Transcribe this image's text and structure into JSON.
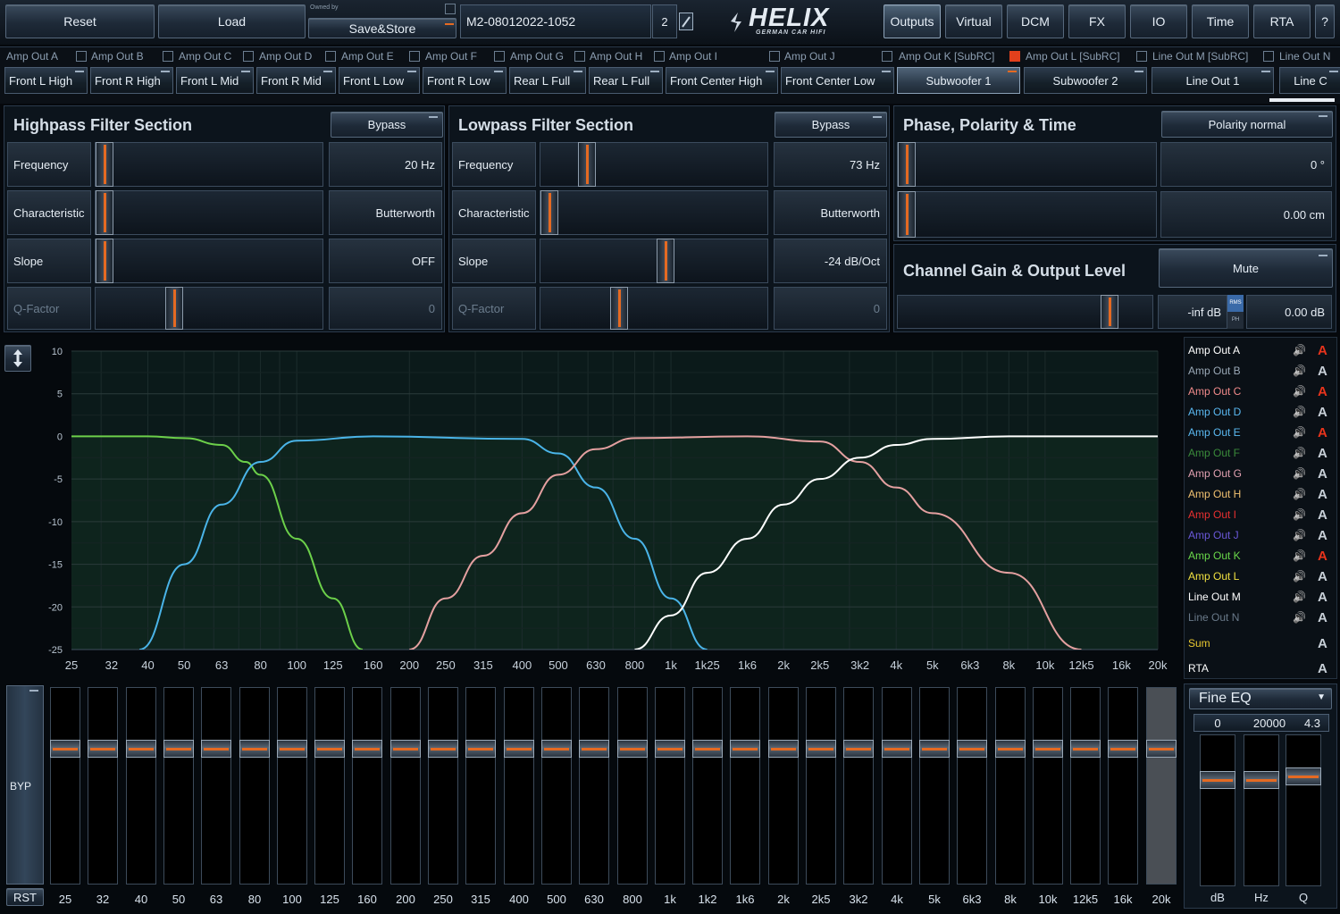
{
  "topbar": {
    "reset": "Reset",
    "load": "Load",
    "owned_by": "Owned by",
    "save_store": "Save&Store",
    "preset_name": "M2-08012022-1052",
    "preset_number": "2",
    "logo_text": "HELIX",
    "logo_sub": "GERMAN CAR HIFI",
    "nav": [
      "Outputs",
      "Virtual",
      "DCM",
      "FX",
      "IO",
      "Time",
      "RTA",
      "?"
    ],
    "active_nav": "Outputs"
  },
  "channels": {
    "labels": [
      "Amp Out A",
      "Amp Out B",
      "Amp Out C",
      "Amp Out D",
      "Amp Out E",
      "Amp Out F",
      "Amp Out G",
      "Amp Out H",
      "Amp Out I",
      "Amp Out J",
      "Amp Out K [SubRC]",
      "Amp Out L [SubRC]",
      "Line Out M [SubRC]",
      "Line Out N"
    ],
    "names": [
      "Front L High",
      "Front R High",
      "Front L Mid",
      "Front R Mid",
      "Front L Low",
      "Front R Low",
      "Rear L Full",
      "Rear L Full",
      "Front Center High",
      "Front Center Low",
      "Subwoofer 1",
      "Subwoofer 2",
      "Line Out 1",
      "Line C"
    ],
    "selected": "Subwoofer 1"
  },
  "highpass": {
    "title": "Highpass Filter Section",
    "bypass": "Bypass",
    "rows": [
      {
        "label": "Frequency",
        "value": "20 Hz"
      },
      {
        "label": "Characteristic",
        "value": "Butterworth"
      },
      {
        "label": "Slope",
        "value": "OFF"
      },
      {
        "label": "Q-Factor",
        "value": "0"
      }
    ],
    "positions": [
      0.0,
      0.0,
      0.0,
      0.33
    ]
  },
  "lowpass": {
    "title": "Lowpass Filter Section",
    "bypass": "Bypass",
    "rows": [
      {
        "label": "Frequency",
        "value": "73 Hz"
      },
      {
        "label": "Characteristic",
        "value": "Butterworth"
      },
      {
        "label": "Slope",
        "value": "-24 dB/Oct"
      },
      {
        "label": "Q-Factor",
        "value": "0"
      }
    ],
    "positions": [
      0.18,
      0.0,
      0.55,
      0.33
    ]
  },
  "phase": {
    "title": "Phase, Polarity & Time",
    "polarity": "Polarity normal",
    "phase_value": "0 °",
    "time_value": "0.00 cm"
  },
  "gain": {
    "title": "Channel Gain & Output Level",
    "mute": "Mute",
    "level": "-inf dB",
    "gain": "0.00 dB",
    "toggle_top": "RMS",
    "toggle_bottom": "PH",
    "gain_position": 0.85
  },
  "legend": {
    "items": [
      {
        "label": "Amp Out A",
        "color": "#ffffff",
        "a_color": "#e8341c"
      },
      {
        "label": "Amp Out B",
        "color": "#9aa8b6",
        "a_color": "#c8d0d8"
      },
      {
        "label": "Amp Out C",
        "color": "#f08a8a",
        "a_color": "#e8341c"
      },
      {
        "label": "Amp Out D",
        "color": "#5ab8f0",
        "a_color": "#c8d0d8"
      },
      {
        "label": "Amp Out E",
        "color": "#5ab8f0",
        "a_color": "#e8341c"
      },
      {
        "label": "Amp Out F",
        "color": "#3a8a3a",
        "a_color": "#c8d0d8"
      },
      {
        "label": "Amp Out G",
        "color": "#e0a0b0",
        "a_color": "#c8d0d8"
      },
      {
        "label": "Amp Out H",
        "color": "#f0c070",
        "a_color": "#c8d0d8"
      },
      {
        "label": "Amp Out I",
        "color": "#e83030",
        "a_color": "#c8d0d8"
      },
      {
        "label": "Amp Out J",
        "color": "#6a58d8",
        "a_color": "#c8d0d8"
      },
      {
        "label": "Amp Out K",
        "color": "#6ad84a",
        "a_color": "#e8341c"
      },
      {
        "label": "Amp Out L",
        "color": "#f0e040",
        "a_color": "#c8d0d8"
      },
      {
        "label": "Line Out M",
        "color": "#ffffff",
        "a_color": "#c8d0d8"
      },
      {
        "label": "Line Out N",
        "color": "#6a7a8a",
        "a_color": "#c8d0d8"
      }
    ],
    "sum": "Sum",
    "sum_color": "#e8c830",
    "rta": "RTA"
  },
  "chart_data": {
    "type": "line",
    "x_ticks": [
      "25",
      "32",
      "40",
      "50",
      "63",
      "80",
      "100",
      "125",
      "160",
      "200",
      "250",
      "315",
      "400",
      "500",
      "630",
      "800",
      "1k",
      "1k25",
      "1k6",
      "2k",
      "2k5",
      "3k2",
      "4k",
      "5k",
      "6k3",
      "8k",
      "10k",
      "12k5",
      "16k",
      "20k"
    ],
    "y_ticks": [
      "10",
      "5",
      "0",
      "-5",
      "-10",
      "-15",
      "-20",
      "-25"
    ],
    "ylim": [
      -25,
      10
    ],
    "xlim": [
      25,
      20000
    ],
    "x_scale": "log",
    "grid": true,
    "series": [
      {
        "color": "#6cd04a",
        "x": [
          25,
          40,
          50,
          63,
          73,
          80,
          100,
          125,
          150
        ],
        "y": [
          0,
          0,
          -0.2,
          -1,
          -3,
          -4.5,
          -12,
          -19,
          -25
        ]
      },
      {
        "color": "#4ab4e8",
        "x": [
          38,
          50,
          63,
          80,
          100,
          160,
          400,
          500,
          630,
          800,
          1000,
          1250
        ],
        "y": [
          -25,
          -15,
          -8,
          -3,
          -0.5,
          0,
          -0.3,
          -2,
          -6,
          -12,
          -19,
          -25
        ]
      },
      {
        "color": "#e4a0a0",
        "x": [
          200,
          250,
          315,
          400,
          500,
          630,
          800,
          1600,
          2500,
          3200,
          4000,
          5000,
          8000,
          12500
        ],
        "y": [
          -25,
          -19,
          -14,
          -9,
          -4.5,
          -1.5,
          -0.2,
          0,
          -0.6,
          -3,
          -6,
          -9,
          -16,
          -25
        ]
      },
      {
        "color": "#ffffff",
        "x": [
          800,
          1000,
          1250,
          1600,
          2000,
          2500,
          3200,
          4000,
          5000,
          8000,
          20000
        ],
        "y": [
          -25,
          -21,
          -16,
          -12,
          -8,
          -5,
          -2.5,
          -1,
          -0.3,
          0,
          0
        ]
      }
    ]
  },
  "graph_icon": "vertical-arrows-icon",
  "eq": {
    "freqs": [
      "25",
      "32",
      "40",
      "50",
      "63",
      "80",
      "100",
      "125",
      "160",
      "200",
      "250",
      "315",
      "400",
      "500",
      "630",
      "800",
      "1k",
      "1k2",
      "1k6",
      "2k",
      "2k5",
      "3k2",
      "4k",
      "5k",
      "6k3",
      "8k",
      "10k",
      "12k5",
      "16k",
      "20k"
    ],
    "gain_db": [
      0,
      0,
      0,
      0,
      0,
      0,
      0,
      0,
      0,
      0,
      0,
      0,
      0,
      0,
      0,
      0,
      0,
      0,
      0,
      0,
      0,
      0,
      0,
      0,
      0,
      0,
      0,
      0,
      0,
      0
    ],
    "byp": "BYP",
    "rst": "RST"
  },
  "fine_eq": {
    "title": "Fine EQ",
    "values": [
      "0",
      "20000",
      "4.3"
    ],
    "labels": [
      "dB",
      "Hz",
      "Q"
    ]
  },
  "accent_color": "#e56a22"
}
